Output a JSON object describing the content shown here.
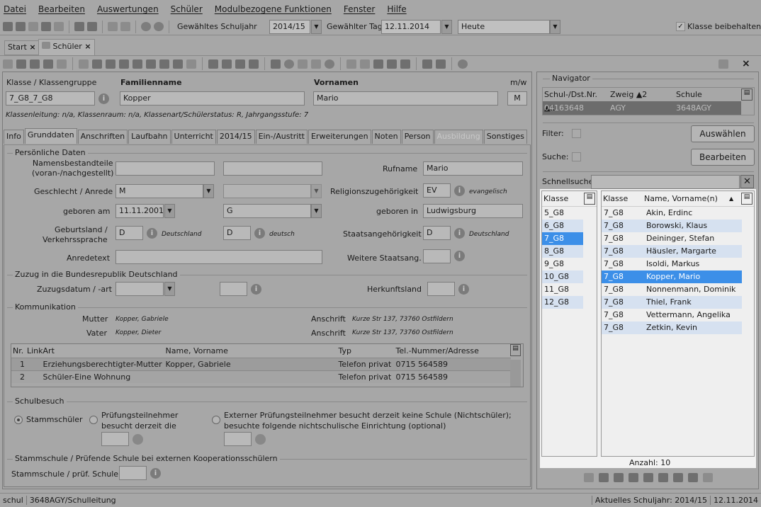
{
  "menu": [
    "Datei",
    "Bearbeiten",
    "Auswertungen",
    "Schüler",
    "Modulbezogene Funktionen",
    "Fenster",
    "Hilfe"
  ],
  "toolbar": {
    "schuljahr_label": "Gewähltes Schuljahr",
    "schuljahr": "2014/15",
    "tag_label": "Gewählter Tag",
    "tag": "12.11.2014",
    "heute": "Heute",
    "klasse_beibehalten": "Klasse beibehalten"
  },
  "doc_tabs": [
    "Start",
    "Schüler"
  ],
  "header": {
    "klasse_label": "Klasse / Klassengruppe",
    "klasse": "7_G8_7_G8",
    "familienname_label": "Familienname",
    "familienname": "Kopper",
    "vornamen_label": "Vornamen",
    "vornamen": "Mario",
    "mw_label": "m/w",
    "mw": "M",
    "info": "Klassenleitung: n/a, Klassenraum: n/a, Klassenart/Schülerstatus: R, Jahrgangsstufe: 7"
  },
  "tabs": [
    "Info",
    "Grunddaten",
    "Anschriften",
    "Laufbahn",
    "Unterricht",
    "2014/15",
    "Ein-/Austritt",
    "Erweiterungen",
    "Noten",
    "Person",
    "Ausbildung",
    "Sonstiges"
  ],
  "persoenlich": {
    "title": "Persönliche Daten",
    "namensbestandteile": "Namensbestandteile",
    "namensbestandteile2": "(voran-/nachgestellt)",
    "rufname_label": "Rufname",
    "rufname": "Mario",
    "geschlecht_label": "Geschlecht / Anrede",
    "geschlecht": "M",
    "religion_label": "Religionszugehörigkeit",
    "religion": "EV",
    "religion_text": "evangelisch",
    "geboren_am_label": "geboren am",
    "geboren_am": "11.11.2001",
    "g_value": "G",
    "geboren_in_label": "geboren in",
    "geboren_in": "Ludwigsburg",
    "geburtsland_label1": "Geburtsland /",
    "geburtsland_label2": "Verkehrssprache",
    "geburtsland": "D",
    "geburtsland_text": "Deutschland",
    "sprache": "D",
    "sprache_text": "deutsch",
    "staat_label": "Staatsangehörigkeit",
    "staat": "D",
    "staat_text": "Deutschland",
    "anredetext_label": "Anredetext",
    "weitere_label": "Weitere Staatsang."
  },
  "zuzug": {
    "title": "Zuzug in die Bundesrepublik Deutschland",
    "datum_label": "Zuzugsdatum / -art",
    "herkunft_label": "Herkunftsland"
  },
  "kommunikation": {
    "title": "Kommunikation",
    "mutter_label": "Mutter",
    "mutter": "Kopper, Gabriele",
    "vater_label": "Vater",
    "vater": "Kopper, Dieter",
    "anschrift_label": "Anschrift",
    "anschrift1": "Kurze Str 137, 73760 Ostfildern",
    "anschrift2": "Kurze Str 137, 73760 Ostfildern",
    "columns": [
      "Nr.",
      "Link",
      "Art",
      "Name, Vorname",
      "Typ",
      "Tel.-Nummer/Adresse"
    ],
    "rows": [
      [
        "1",
        "",
        "Erziehungsberechtigter-Mutter",
        "Kopper, Gabriele",
        "Telefon privat",
        "0715 564589"
      ],
      [
        "2",
        "",
        "Schüler-Eine Wohnung",
        "",
        "Telefon privat",
        "0715 564589"
      ]
    ]
  },
  "schulbesuch": {
    "title": "Schulbesuch",
    "stamm": "Stammschüler",
    "pruef1": "Prüfungsteilnehmer",
    "pruef2": "besucht derzeit die",
    "extern1": "Externer Prüfungsteilnehmer besucht derzeit keine Schule (Nichtschüler);",
    "extern2": "besuchte folgende nichtschulische Einrichtung (optional)"
  },
  "stammschule": {
    "title": "Stammschule / Prüfende Schule bei externen Kooperationsschülern",
    "label": "Stammschule / prüf. Schule"
  },
  "navigator": {
    "title": "Navigator",
    "columns": [
      "Schul-/Dst.Nr. ▲1",
      "Zweig ▲2",
      "Schule"
    ],
    "row": [
      "04163648",
      "AGY",
      "3648AGY"
    ],
    "filter": "Filter:",
    "suche": "Suche:",
    "auswaehlen": "Auswählen",
    "bearbeiten": "Bearbeiten",
    "schnellsuche": "Schnellsuche",
    "klasse_col": "Klasse",
    "name_col": "Name, Vorname(n)",
    "klassen": [
      "5_G8",
      "6_G8",
      "7_G8",
      "8_G8",
      "9_G8",
      "10_G8",
      "11_G8",
      "12_G8"
    ],
    "students": [
      [
        "7_G8",
        "Akin, Erdinc"
      ],
      [
        "7_G8",
        "Borowski, Klaus"
      ],
      [
        "7_G8",
        "Deininger, Stefan"
      ],
      [
        "7_G8",
        "Häusler, Margarte"
      ],
      [
        "7_G8",
        "Isoldi, Markus"
      ],
      [
        "7_G8",
        "Kopper, Mario"
      ],
      [
        "7_G8",
        "Nonnenmann, Dominik"
      ],
      [
        "7_G8",
        "Thiel, Frank"
      ],
      [
        "7_G8",
        "Vettermann, Angelika"
      ],
      [
        "7_G8",
        "Zetkin, Kevin"
      ]
    ],
    "anzahl": "Anzahl: 10"
  },
  "status": {
    "user": "schul",
    "school": "3648AGY/Schulleitung",
    "jahr": "Aktuelles Schuljahr: 2014/15",
    "date": "12.11.2014"
  },
  "colors": {
    "selection": "#3c8fe8",
    "alt_row": "#d6e1f0"
  }
}
